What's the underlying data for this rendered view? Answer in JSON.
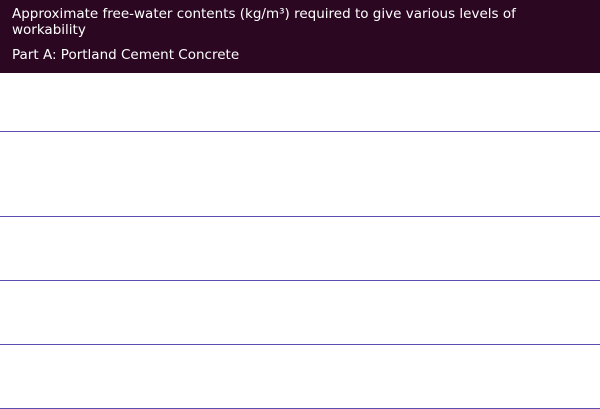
{
  "table": {
    "title": "Approximate free-water contents (kg/m³) required to give various levels of workability",
    "subtitle": "Part A: Portland Cement Concrete",
    "accent_color": "#2b0722",
    "divider_color": "#5a4fb0"
  }
}
